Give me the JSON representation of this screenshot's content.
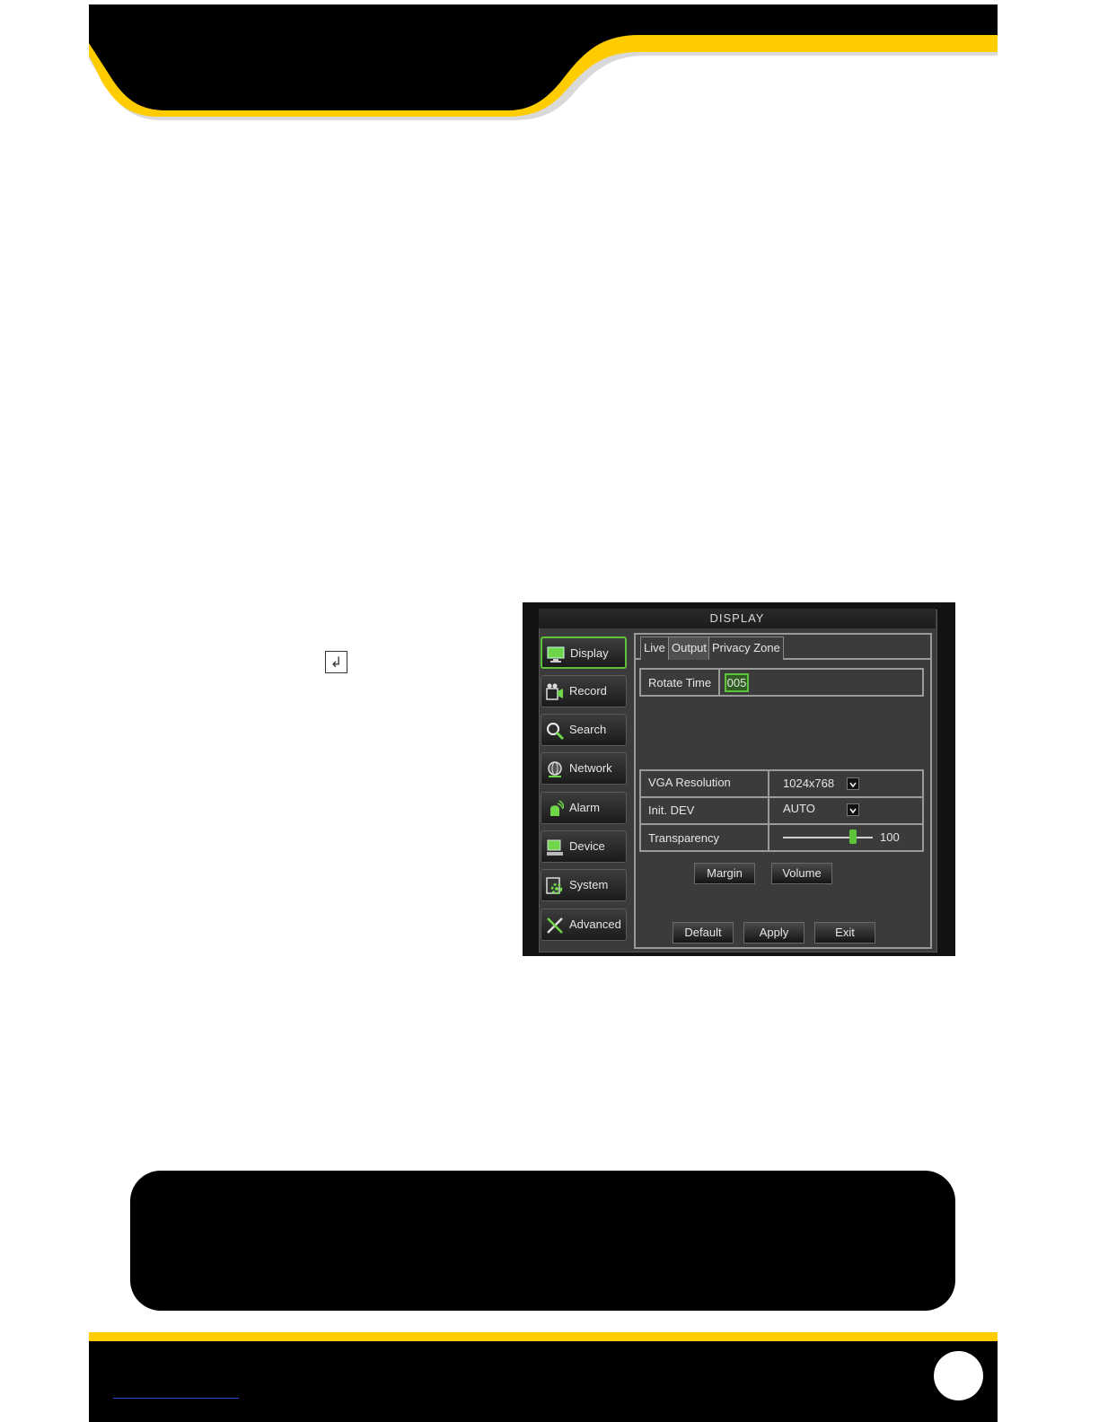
{
  "enter_key_glyph": "↲",
  "dvr": {
    "title": "DISPLAY",
    "sidebar": [
      {
        "label": "Display",
        "icon": "monitor-icon",
        "active": true
      },
      {
        "label": "Record",
        "icon": "record-camera-icon",
        "active": false
      },
      {
        "label": "Search",
        "icon": "magnifier-icon",
        "active": false
      },
      {
        "label": "Network",
        "icon": "network-globe-icon",
        "active": false
      },
      {
        "label": "Alarm",
        "icon": "alarm-icon",
        "active": false
      },
      {
        "label": "Device",
        "icon": "device-icon",
        "active": false
      },
      {
        "label": "System",
        "icon": "system-gear-icon",
        "active": false
      },
      {
        "label": "Advanced",
        "icon": "tools-icon",
        "active": false
      }
    ],
    "tabs": [
      {
        "label": "Live",
        "active": false
      },
      {
        "label": "Output",
        "active": true
      },
      {
        "label": "Privacy Zone",
        "active": false
      }
    ],
    "rotate_time": {
      "label": "Rotate Time",
      "value": "005"
    },
    "settings": [
      {
        "label": "VGA Resolution",
        "value": "1024x768"
      },
      {
        "label": "Init. DEV",
        "value": "AUTO"
      },
      {
        "label": "Transparency",
        "value": "100",
        "slider_fraction": 0.78
      }
    ],
    "buttons": {
      "margin": "Margin",
      "volume": "Volume",
      "default": "Default",
      "apply": "Apply",
      "exit": "Exit"
    }
  },
  "colors": {
    "brand_yellow": "#ffcc00",
    "brand_black": "#000000",
    "active_green": "#5ec23a"
  }
}
